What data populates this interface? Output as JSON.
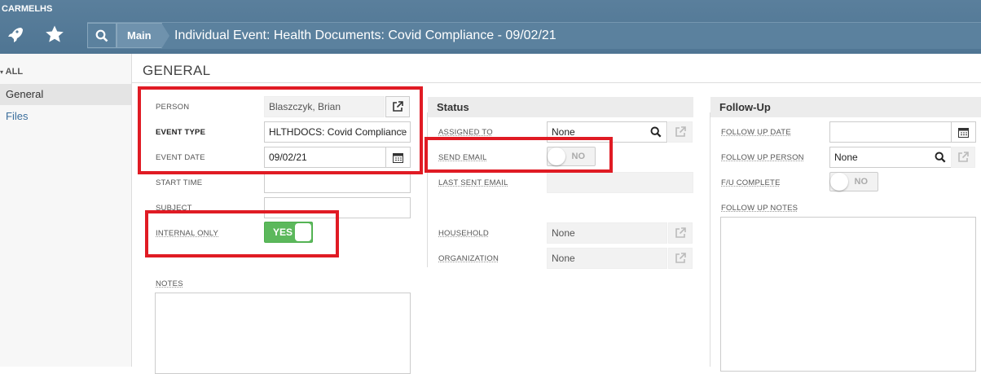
{
  "topbar": {
    "brand": "CARMELHS",
    "icons": [
      "rocket-icon",
      "star-icon",
      "search-icon"
    ],
    "crumb_main": "Main",
    "crumb_title": "Individual Event: Health Documents: Covid Compliance - 09/02/21"
  },
  "sidebar": {
    "all_label": "ALL",
    "items": [
      {
        "label": "General",
        "active": true
      },
      {
        "label": "Files",
        "active": false
      }
    ]
  },
  "main": {
    "section_title": "GENERAL",
    "left": {
      "person_label": "PERSON",
      "person_value": "Blaszczyk, Brian",
      "event_type_label": "EVENT TYPE",
      "event_type_value": "HLTHDOCS: Covid Compliance",
      "event_date_label": "EVENT DATE",
      "event_date_value": "09/02/21",
      "start_time_label": "START TIME",
      "start_time_value": "",
      "subject_label": "SUBJECT",
      "subject_value": "",
      "internal_only_label": "INTERNAL ONLY",
      "internal_only_value": "YES",
      "notes_label": "NOTES"
    },
    "status": {
      "heading": "Status",
      "assigned_to_label": "ASSIGNED TO",
      "assigned_to_value": "None",
      "send_email_label": "SEND EMAIL",
      "send_email_value": "NO",
      "last_sent_email_label": "LAST SENT EMAIL",
      "household_label": "HOUSEHOLD",
      "household_value": "None",
      "organization_label": "ORGANIZATION",
      "organization_value": "None"
    },
    "followup": {
      "heading": "Follow-Up",
      "follow_up_date_label": "FOLLOW UP DATE",
      "follow_up_date_value": "",
      "follow_up_person_label": "FOLLOW UP PERSON",
      "follow_up_person_value": "None",
      "fu_complete_label": "F/U COMPLETE",
      "fu_complete_value": "NO",
      "follow_up_notes_label": "FOLLOW UP NOTES"
    }
  },
  "colors": {
    "topbar": "#4f7593",
    "toggle_on": "#5cb85c",
    "highlight": "#e01b24",
    "link": "#3b6e9c"
  }
}
